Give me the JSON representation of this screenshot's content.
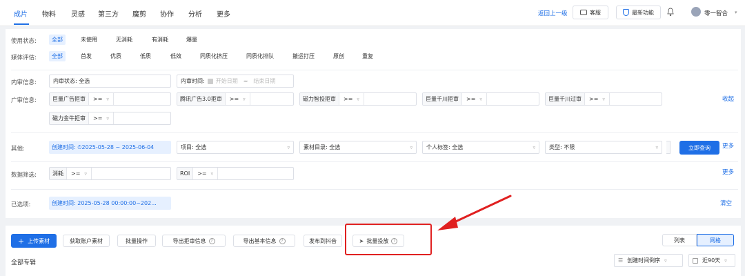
{
  "nav": {
    "tabs": [
      "成片",
      "物料",
      "灵感",
      "第三方",
      "魔剪",
      "协作",
      "分析",
      "更多"
    ],
    "back_label": "返回上一级",
    "service_label": "客服",
    "new_features_label": "最新功能",
    "user_name": "零一智合"
  },
  "filters": {
    "usage": {
      "label": "使用状态:",
      "options": [
        "全部",
        "未使用",
        "无消耗",
        "有消耗",
        "爆量"
      ]
    },
    "media": {
      "label": "媒体评估:",
      "options": [
        "全部",
        "首发",
        "优质",
        "低质",
        "低效",
        "同质化挤压",
        "同质化排队",
        "搬运打压",
        "原创",
        "重复"
      ]
    },
    "internal": {
      "label": "内审信息:",
      "status": "内审状态: 全选",
      "time_label": "内审时间:",
      "start_placeholder": "开始日期",
      "sep": "~",
      "end_placeholder": "结束日期"
    },
    "ad": {
      "label": "广审信息:",
      "items": [
        "巨量广告拒审",
        "腾讯广告3.0拒审",
        "磁力智投拒审",
        "巨量千川拒审",
        "巨量千川过审",
        "磁力金牛拒审"
      ],
      "op": ">=",
      "collapse_label": "收起"
    },
    "other": {
      "label": "其他:",
      "created": "创建时间: ⏱2025-05-28 ~ 2025-06-04",
      "project": "项目: 全选",
      "catalog": "素材目录: 全选",
      "personal_tag": "个人标签: 全选",
      "type": "类型: 不限",
      "query_label": "立即查询",
      "more_label": "更多"
    },
    "data": {
      "label": "数据筛选:",
      "items": [
        "消耗",
        "ROI"
      ],
      "op": ">=",
      "more_label": "更多"
    },
    "selected": {
      "label": "已选项:",
      "chip": "创建时间: 2025-05-28 00:00:00~202...",
      "clear_label": "清空"
    }
  },
  "toolbar": {
    "upload_label": "上传素材",
    "fetch_label": "获取账户素材",
    "batch_label": "批量操作",
    "export_reject_label": "导出拒审信息",
    "export_basic_label": "导出基本信息",
    "publish_douyin_label": "发布到抖音",
    "batch_deliver_label": "批量投放",
    "view_list_label": "列表",
    "view_grid_label": "网格"
  },
  "footer": {
    "album_label": "全部专辑",
    "sort_label": "创建时间倒序",
    "range_label": "近90天"
  },
  "annotation_color": "#e02020",
  "accent_color": "#1f6fe6"
}
